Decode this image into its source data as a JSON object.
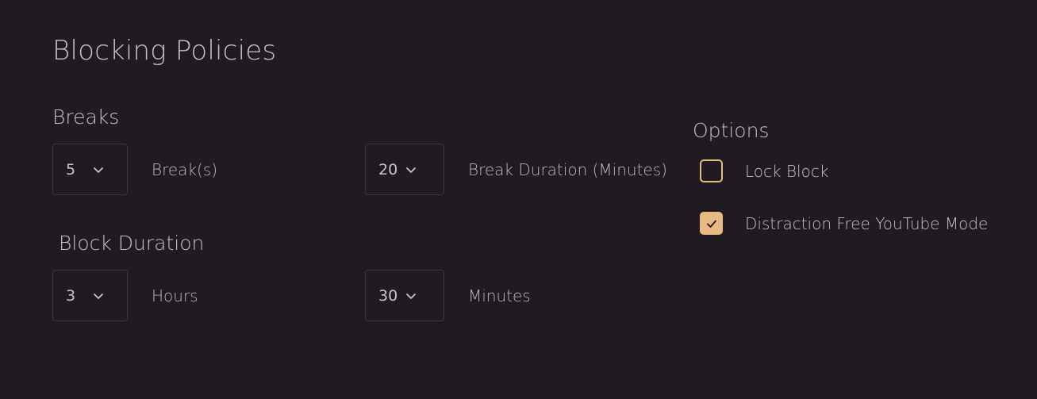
{
  "page": {
    "title": "Blocking Policies"
  },
  "breaks": {
    "title": "Breaks",
    "count": {
      "value": "5",
      "label": "Break(s)"
    },
    "duration": {
      "value": "20",
      "label": "Break Duration (Minutes)"
    }
  },
  "block_duration": {
    "title": "Block Duration",
    "hours": {
      "value": "3",
      "label": "Hours"
    },
    "minutes": {
      "value": "30",
      "label": "Minutes"
    }
  },
  "options": {
    "title": "Options",
    "items": [
      {
        "label": "Lock Block",
        "checked": false
      },
      {
        "label": "Distraction Free YouTube Mode",
        "checked": true
      }
    ]
  },
  "colors": {
    "background": "#1f1b21",
    "accent": "#e8b982",
    "border": "#3a3540",
    "text": "#c8c5cc"
  },
  "icons": [
    "chevron-down-icon",
    "checkmark-icon"
  ]
}
